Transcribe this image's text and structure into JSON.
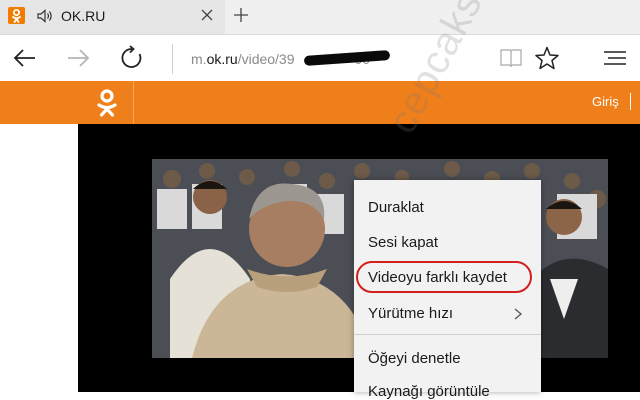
{
  "browser": {
    "tab_title": "OK.RU",
    "url_prefix": "m.",
    "url_domain": "ok.ru",
    "url_path": "/video/39",
    "url_tail": "00"
  },
  "site": {
    "login_label": "Giriş",
    "brand_color": "#ef7f1b"
  },
  "context_menu": {
    "items": [
      {
        "label": "Duraklat"
      },
      {
        "label": "Sesi kapat"
      },
      {
        "label": "Videoyu farklı kaydet",
        "highlighted": true
      },
      {
        "label": "Yürütme hızı",
        "has_submenu": true
      },
      {
        "label": "Öğeyi denetle"
      },
      {
        "label": "Kaynağı görüntüle"
      }
    ],
    "highlight_color": "#d31e1e"
  },
  "watermark": "cepcaksoru.com",
  "icons": [
    "ok-logo-icon",
    "speaker-icon",
    "close-icon",
    "plus-icon",
    "back-arrow-icon",
    "forward-arrow-icon",
    "reload-icon",
    "reading-view-icon",
    "star-icon",
    "menu-icon",
    "chevron-right-icon"
  ]
}
